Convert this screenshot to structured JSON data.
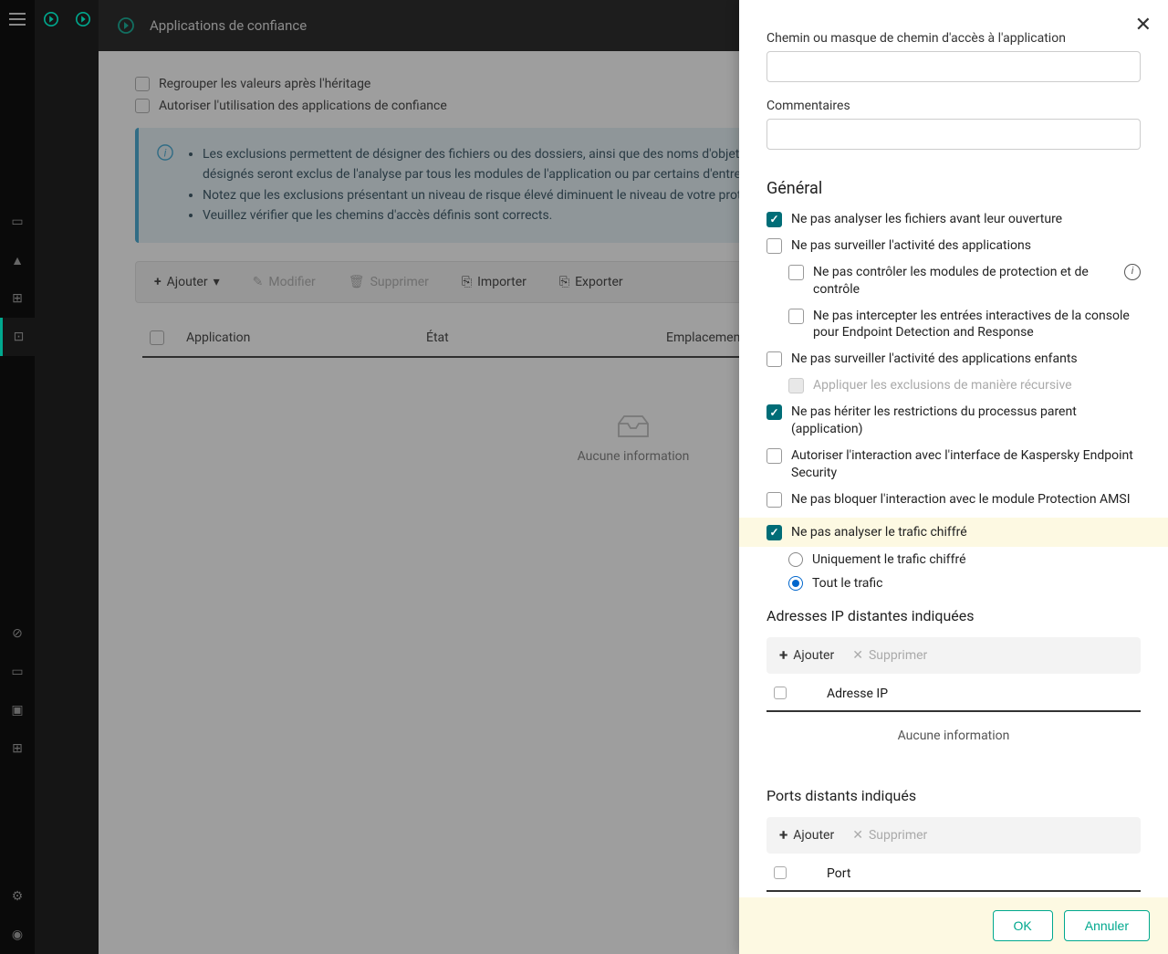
{
  "header": {
    "title": "Applications de confiance"
  },
  "main": {
    "checkbox1": "Regrouper les valeurs après l'héritage",
    "checkbox2": "Autoriser l'utilisation des applications de confiance",
    "info": {
      "item1": "Les exclusions permettent de désigner des fichiers ou des dossiers, ainsi que des noms d'objets selon la classification de l'Encyclopédie des virus. Les objets désignés seront exclus de l'analyse par tous les modules de l'application ou par certains d'entre eux.",
      "item2": "Notez que les exclusions présentant un niveau de risque élevé diminuent le niveau de votre protection.",
      "item3": "Veuillez vérifier que les chemins d'accès définis sont corrects."
    },
    "toolbar": {
      "add": "Ajouter",
      "modify": "Modifier",
      "delete": "Supprimer",
      "import": "Importer",
      "export": "Exporter"
    },
    "table": {
      "col1": "Application",
      "col2": "État",
      "col3": "Emplacement",
      "empty": "Aucune information"
    }
  },
  "panel": {
    "path_label": "Chemin ou masque de chemin d'accès à l'application",
    "comments_label": "Commentaires",
    "general_title": "Général",
    "opt_scan_before_open": "Ne pas analyser les fichiers avant leur ouverture",
    "opt_monitor_activity": "Ne pas surveiller l'activité des applications",
    "opt_control_modules": "Ne pas contrôler les modules de protection et de contrôle",
    "opt_intercept_edr": "Ne pas intercepter les entrées interactives de la console pour Endpoint Detection and Response",
    "opt_child_activity": "Ne pas surveiller l'activité des applications enfants",
    "opt_recursive": "Appliquer les exclusions de manière récursive",
    "opt_inherit": "Ne pas hériter les restrictions du processus parent (application)",
    "opt_allow_ui": "Autoriser l'interaction avec l'interface de Kaspersky Endpoint Security",
    "opt_amsi": "Ne pas bloquer l'interaction avec le module Protection AMSI",
    "opt_encrypted": "Ne pas analyser le trafic chiffré",
    "radio_encrypted_only": "Uniquement le trafic chiffré",
    "radio_all_traffic": "Tout le trafic",
    "ip_section": "Adresses IP distantes indiquées",
    "port_section": "Ports distants indiqués",
    "add_btn": "Ajouter",
    "delete_btn": "Supprimer",
    "ip_col": "Adresse IP",
    "port_col": "Port",
    "no_info": "Aucune information",
    "ok": "OK",
    "cancel": "Annuler"
  }
}
